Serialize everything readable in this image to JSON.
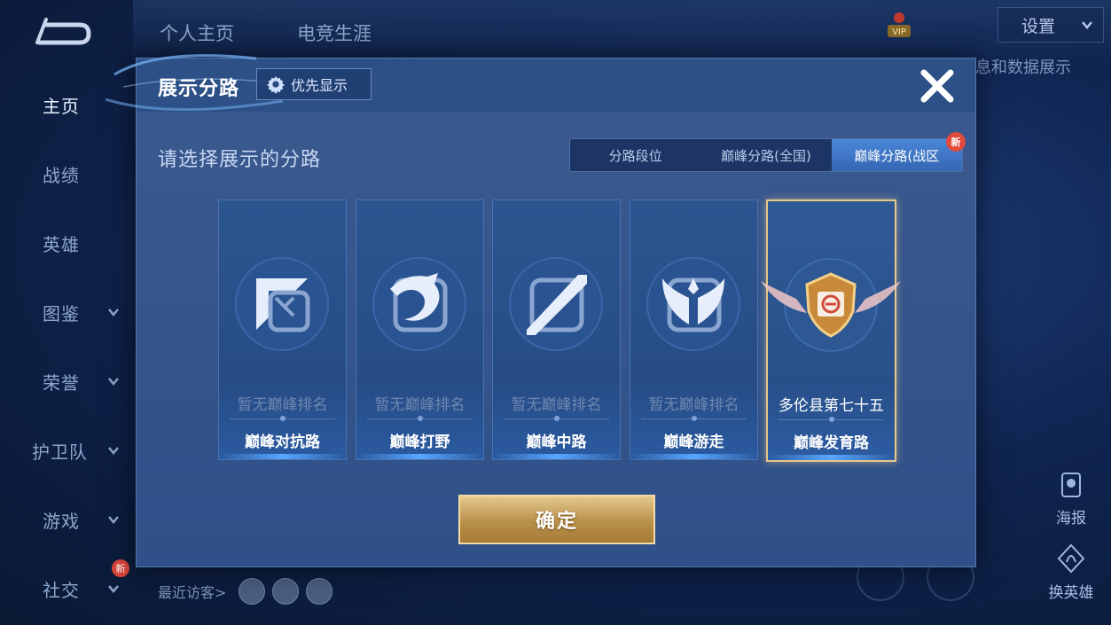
{
  "sidebar": {
    "items": [
      {
        "label": "主页",
        "active": true,
        "chevron": false
      },
      {
        "label": "战绩",
        "active": false,
        "chevron": false
      },
      {
        "label": "英雄",
        "active": false,
        "chevron": false
      },
      {
        "label": "图鉴",
        "active": false,
        "chevron": true
      },
      {
        "label": "荣誉",
        "active": false,
        "chevron": true
      },
      {
        "label": "护卫队",
        "active": false,
        "chevron": true
      },
      {
        "label": "游戏",
        "active": false,
        "chevron": true
      },
      {
        "label": "社交",
        "active": false,
        "chevron": true
      }
    ],
    "social_new_badge": "新"
  },
  "top": {
    "tabs": [
      "个人主页",
      "电竞生涯"
    ],
    "settings_label": "设置",
    "vip_label": "VIP",
    "right_peek": "息和数据展示"
  },
  "right_actions": {
    "poster": "海报",
    "change_hero": "换英雄"
  },
  "bottom": {
    "recent_visitors_label": "最近访客>"
  },
  "modal": {
    "title": "展示分路",
    "priority_button": "优先显示",
    "prompt": "请选择展示的分路",
    "segments": [
      {
        "label": "分路段位",
        "active": false
      },
      {
        "label": "巅峰分路(全国)",
        "active": false
      },
      {
        "label": "巅峰分路(战区",
        "active": true
      }
    ],
    "new_tag": "新",
    "cards": [
      {
        "rank": "暂无巅峰排名",
        "name": "巅峰对抗路",
        "icon": "clash-lane-icon",
        "selected": false
      },
      {
        "rank": "暂无巅峰排名",
        "name": "巅峰打野",
        "icon": "jungle-dragon-icon",
        "selected": false
      },
      {
        "rank": "暂无巅峰排名",
        "name": "巅峰中路",
        "icon": "mid-lane-icon",
        "selected": false
      },
      {
        "rank": "暂无巅峰排名",
        "name": "巅峰游走",
        "icon": "roam-wings-icon",
        "selected": false
      },
      {
        "rank": "多伦县第七十五",
        "name": "巅峰发育路",
        "icon": "gold-winged-badge-icon",
        "selected": true
      }
    ],
    "confirm_button": "确定"
  },
  "colors": {
    "accent_blue": "#3567b4",
    "gold": "#b9904a",
    "selected_border": "#e7c88a",
    "new_badge": "#e24a3c"
  }
}
